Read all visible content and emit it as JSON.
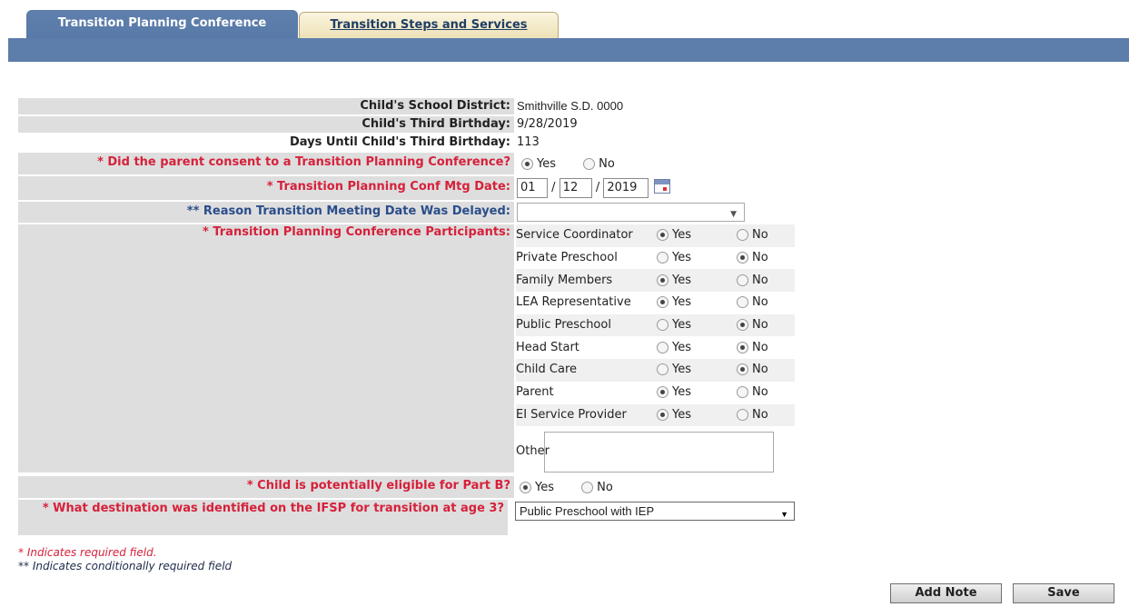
{
  "tabs": {
    "active": "Transition Planning Conference",
    "inactive": "Transition Steps and Services"
  },
  "fields": {
    "district_label": "Child's School District:",
    "district_value": "Smithville S.D. 0000",
    "birthday_label": "Child's Third Birthday:",
    "birthday_value": "9/28/2019",
    "days_label": "Days Until Child's Third Birthday:",
    "days_value": "113",
    "consent_label": "* Did the parent consent to a Transition Planning Conference?",
    "consent_value": "Yes",
    "meeting_date_label": "* Transition Planning Conf Mtg Date:",
    "meeting_month": "01",
    "meeting_day": "12",
    "meeting_year": "2019",
    "date_separator": "/",
    "delay_label": "** Reason Transition Meeting Date Was Delayed:",
    "delay_value": "",
    "participants_label": "* Transition Planning Conference Participants:",
    "partb_label": "* Child is potentially eligible for Part B?",
    "partb_value": "Yes",
    "destination_label": "* What destination was identified on the IFSP for transition at age 3?",
    "destination_value": "Public Preschool with IEP"
  },
  "radio_labels": {
    "yes": "Yes",
    "no": "No"
  },
  "participants": [
    {
      "name": "Service Coordinator",
      "selected": "Yes"
    },
    {
      "name": "Private Preschool",
      "selected": "No"
    },
    {
      "name": "Family Members",
      "selected": "Yes"
    },
    {
      "name": "LEA Representative",
      "selected": "Yes"
    },
    {
      "name": "Public Preschool",
      "selected": "No"
    },
    {
      "name": "Head Start",
      "selected": "No"
    },
    {
      "name": "Child Care",
      "selected": "No"
    },
    {
      "name": "Parent",
      "selected": "Yes"
    },
    {
      "name": "EI Service Provider",
      "selected": "Yes"
    }
  ],
  "other_label": "Other",
  "other_value": "",
  "legend": {
    "required": "* Indicates required field.",
    "conditional": "** Indicates conditionally required field"
  },
  "buttons": {
    "add_note": "Add Note",
    "save": "Save"
  },
  "icons": {
    "calendar": "calendar-icon",
    "dropdown": "chevron-down-icon"
  },
  "colors": {
    "required": "#d6213b",
    "conditional": "#2a4d8a",
    "tab_active": "#587aa8"
  }
}
